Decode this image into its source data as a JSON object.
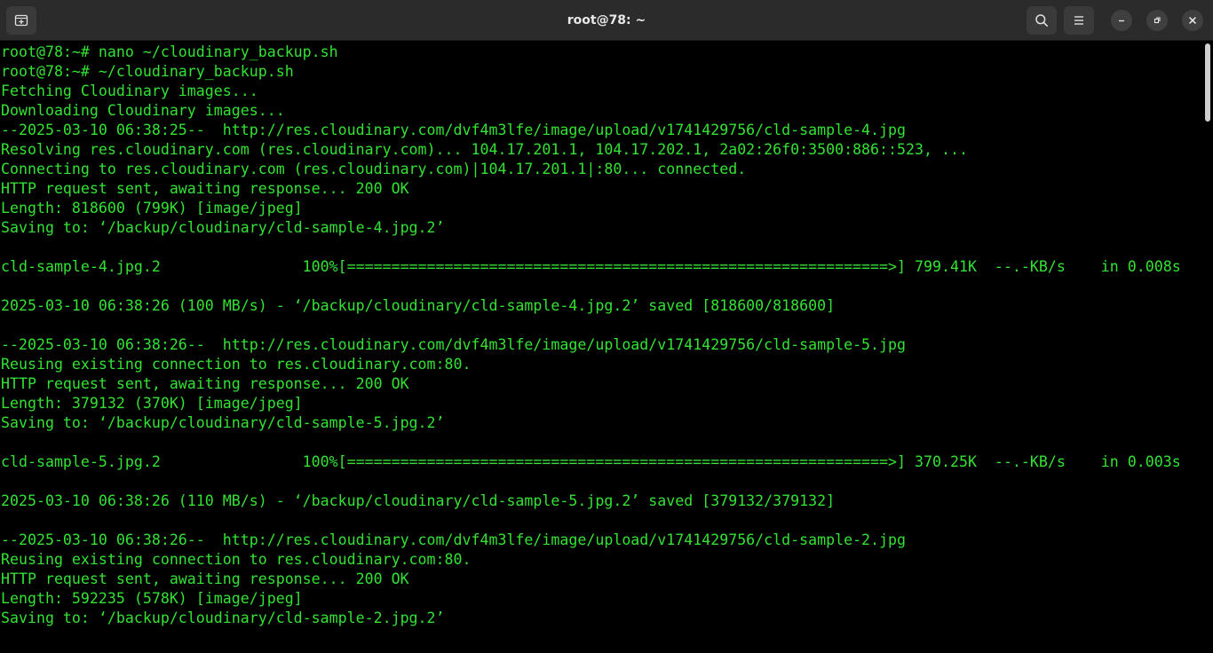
{
  "window": {
    "title": "root@78: ~"
  },
  "titlebar": {
    "new_tab_icon": "new-tab-icon",
    "search_icon": "search-icon",
    "menu_icon": "hamburger-menu-icon",
    "minimize_icon": "minimize-icon",
    "maximize_icon": "restore-icon",
    "close_icon": "close-icon"
  },
  "colors": {
    "titlebar_bg": "#2b2b2b",
    "terminal_bg": "#000000",
    "terminal_fg": "#33e233",
    "title_fg": "#e8e8e8"
  },
  "terminal": {
    "lines": [
      "root@78:~# nano ~/cloudinary_backup.sh",
      "root@78:~# ~/cloudinary_backup.sh",
      "Fetching Cloudinary images...",
      "Downloading Cloudinary images...",
      "--2025-03-10 06:38:25--  http://res.cloudinary.com/dvf4m3lfe/image/upload/v1741429756/cld-sample-4.jpg",
      "Resolving res.cloudinary.com (res.cloudinary.com)... 104.17.201.1, 104.17.202.1, 2a02:26f0:3500:886::523, ...",
      "Connecting to res.cloudinary.com (res.cloudinary.com)|104.17.201.1|:80... connected.",
      "HTTP request sent, awaiting response... 200 OK",
      "Length: 818600 (799K) [image/jpeg]",
      "Saving to: ‘/backup/cloudinary/cld-sample-4.jpg.2’",
      "",
      "cld-sample-4.jpg.2                100%[=============================================================>] 799.41K  --.-KB/s    in 0.008s",
      "",
      "2025-03-10 06:38:26 (100 MB/s) - ‘/backup/cloudinary/cld-sample-4.jpg.2’ saved [818600/818600]",
      "",
      "--2025-03-10 06:38:26--  http://res.cloudinary.com/dvf4m3lfe/image/upload/v1741429756/cld-sample-5.jpg",
      "Reusing existing connection to res.cloudinary.com:80.",
      "HTTP request sent, awaiting response... 200 OK",
      "Length: 379132 (370K) [image/jpeg]",
      "Saving to: ‘/backup/cloudinary/cld-sample-5.jpg.2’",
      "",
      "cld-sample-5.jpg.2                100%[=============================================================>] 370.25K  --.-KB/s    in 0.003s",
      "",
      "2025-03-10 06:38:26 (110 MB/s) - ‘/backup/cloudinary/cld-sample-5.jpg.2’ saved [379132/379132]",
      "",
      "--2025-03-10 06:38:26--  http://res.cloudinary.com/dvf4m3lfe/image/upload/v1741429756/cld-sample-2.jpg",
      "Reusing existing connection to res.cloudinary.com:80.",
      "HTTP request sent, awaiting response... 200 OK",
      "Length: 592235 (578K) [image/jpeg]",
      "Saving to: ‘/backup/cloudinary/cld-sample-2.jpg.2’"
    ]
  }
}
